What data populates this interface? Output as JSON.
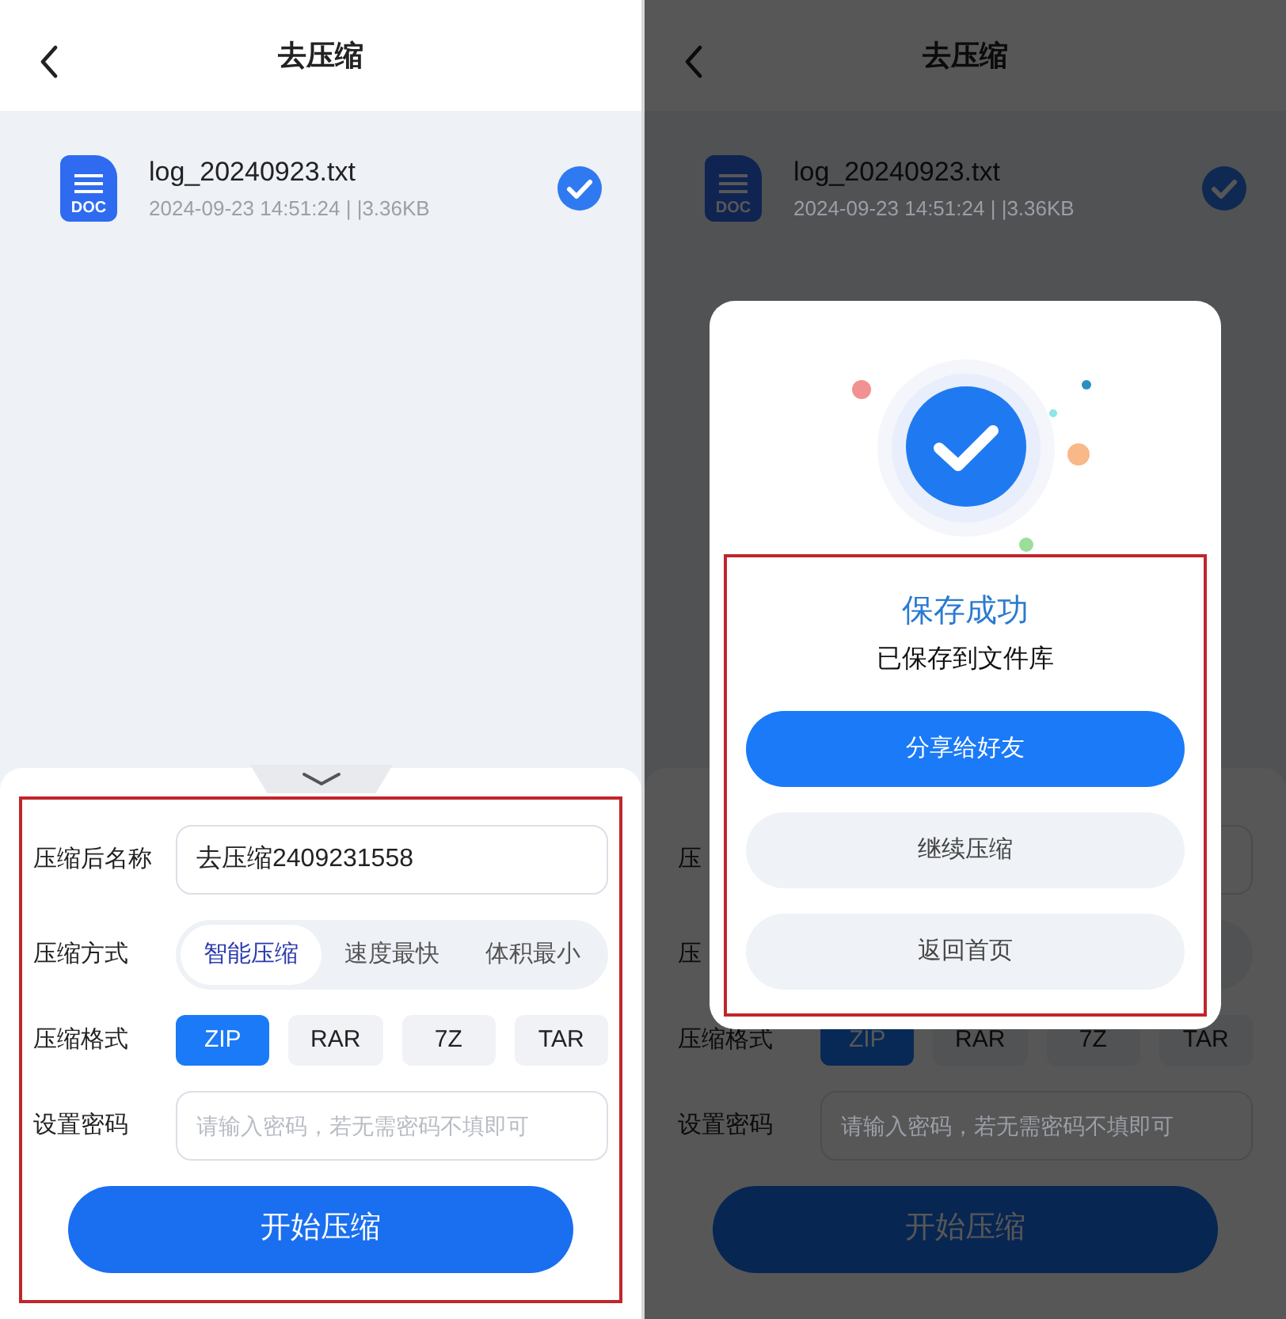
{
  "screens": [
    {
      "header": {
        "title": "去压缩"
      },
      "file": {
        "icon_label": "DOC",
        "name": "log_20240923.txt",
        "meta": "2024-09-23 14:51:24 | |3.36KB",
        "checked": true
      },
      "form": {
        "rows": [
          {
            "kind": "text",
            "label": "压缩后名称",
            "value": "去压缩2409231558"
          },
          {
            "kind": "segmented",
            "label": "压缩方式",
            "options": [
              {
                "label": "智能压缩",
                "selected": true
              },
              {
                "label": "速度最快",
                "selected": false
              },
              {
                "label": "体积最小",
                "selected": false
              }
            ]
          },
          {
            "kind": "chips",
            "label": "压缩格式",
            "options": [
              {
                "label": "ZIP",
                "selected": true
              },
              {
                "label": "RAR",
                "selected": false
              },
              {
                "label": "7Z",
                "selected": false
              },
              {
                "label": "TAR",
                "selected": false
              }
            ]
          },
          {
            "kind": "text",
            "label": "设置密码",
            "placeholder": "请输入密码，若无需密码不填即可"
          }
        ],
        "submit": "开始压缩"
      }
    },
    {
      "header": {
        "title": "去压缩"
      },
      "file": {
        "icon_label": "DOC",
        "name": "log_20240923.txt",
        "meta": "2024-09-23 14:51:24 | |3.36KB",
        "checked": true
      },
      "form": {
        "rows": [
          {
            "kind": "text",
            "label": "压"
          },
          {
            "kind": "segmented",
            "label": "压"
          },
          {
            "kind": "chips",
            "label": "压缩格式",
            "options": [
              {
                "label": "ZIP",
                "selected": true
              },
              {
                "label": "RAR",
                "selected": false
              },
              {
                "label": "7Z",
                "selected": false
              },
              {
                "label": "TAR",
                "selected": false
              }
            ]
          },
          {
            "kind": "text",
            "label": "设置密码",
            "placeholder": "请输入密码，若无需密码不填即可"
          }
        ],
        "submit": "开始压缩"
      },
      "dialog": {
        "title": "保存成功",
        "subtitle": "已保存到文件库",
        "buttons": [
          {
            "label": "分享给好友",
            "kind": "primary"
          },
          {
            "label": "继续压缩",
            "kind": "secondary"
          },
          {
            "label": "返回首页",
            "kind": "secondary"
          }
        ]
      }
    }
  ]
}
